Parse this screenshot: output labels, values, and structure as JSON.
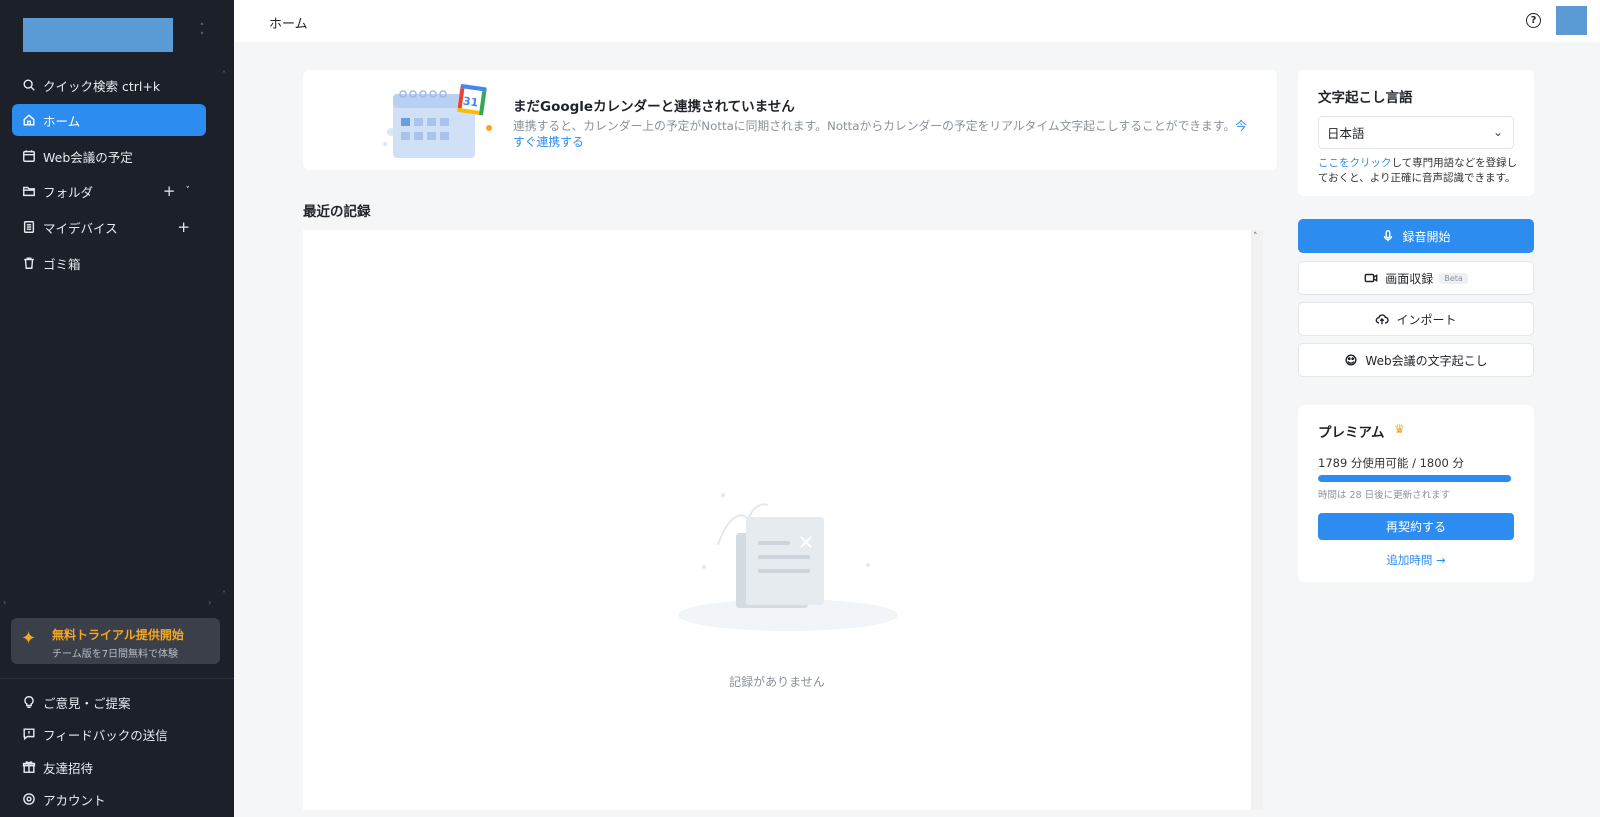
{
  "sidebar": {
    "nav": [
      {
        "label": "クイック検索 ctrl+k",
        "icon": "search-icon"
      },
      {
        "label": "ホーム",
        "icon": "home-icon",
        "active": true
      },
      {
        "label": "Web会議の予定",
        "icon": "calendar-icon"
      },
      {
        "label": "フォルダ",
        "icon": "folder-icon"
      },
      {
        "label": "マイデバイス",
        "icon": "device-icon"
      },
      {
        "label": "ゴミ箱",
        "icon": "trash-icon"
      }
    ],
    "trial": {
      "title": "無料トライアル提供開始",
      "subtitle": "チーム版を7日間無料で体験"
    },
    "bottom": [
      {
        "label": "ご意見・ご提案",
        "icon": "lightbulb-icon"
      },
      {
        "label": "フィードバックの送信",
        "icon": "feedback-icon"
      },
      {
        "label": "友達招待",
        "icon": "gift-icon"
      },
      {
        "label": "アカウント",
        "icon": "account-gear-icon"
      }
    ]
  },
  "header": {
    "breadcrumb": "ホーム",
    "help_glyph": "?"
  },
  "banner": {
    "title": "まだGoogleカレンダーと連携されていません",
    "description": "連携すると、カレンダー上の予定がNottaに同期されます。Nottaからカレンダーの予定をリアルタイム文字起こしすることができます。",
    "link": "今すぐ連携する",
    "calendar_day": "31"
  },
  "records": {
    "section_title": "最近の記録",
    "empty_text": "記録がありません"
  },
  "language": {
    "title": "文字起こし言語",
    "selected": "日本語",
    "note_link": "ここをクリック",
    "note_text": "して専門用語などを登録しておくと、より正確に音声認識できます。"
  },
  "actions": {
    "record": "録音開始",
    "screen_record": "画面収録",
    "beta": "Beta",
    "import": "インポート",
    "web_meeting": "Web会議の文字起こし"
  },
  "premium": {
    "title": "プレミアム",
    "usage": "1789 分使用可能 / 1800 分",
    "usage_fraction": 0.994,
    "renew_note": "時間は 28 日後に更新されます",
    "renew_button": "再契約する",
    "add_time": "追加時間 →"
  },
  "colors": {
    "accent": "#2d8cf0",
    "sidebar": "#1b2029",
    "trial": "#f5a623"
  }
}
